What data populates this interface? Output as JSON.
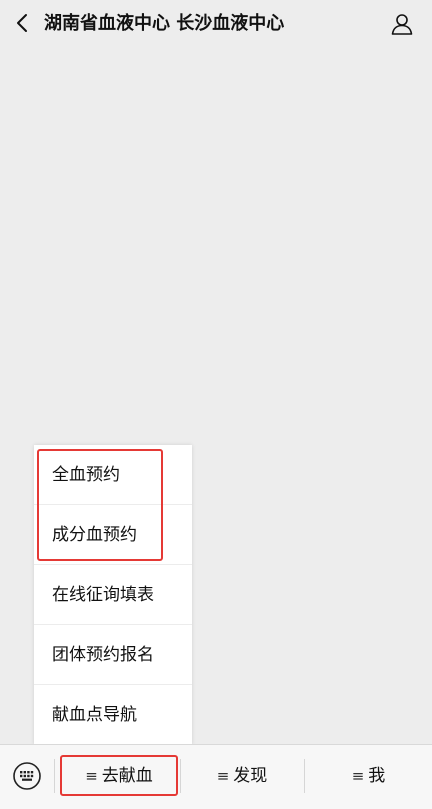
{
  "header": {
    "title": "湖南省血液中心 长沙血液中心"
  },
  "popup_menu": {
    "items": [
      {
        "label": "全血预约"
      },
      {
        "label": "成分血预约"
      },
      {
        "label": "在线征询填表"
      },
      {
        "label": "团体预约报名"
      },
      {
        "label": "献血点导航"
      }
    ]
  },
  "bottom_bar": {
    "tabs": [
      {
        "label": "去献血",
        "glyph": "≡"
      },
      {
        "label": "发现",
        "glyph": "≡"
      },
      {
        "label": "我",
        "glyph": "≡"
      }
    ]
  },
  "colors": {
    "background": "#ededed",
    "highlight": "#e53935"
  },
  "icons": [
    "back-arrow-icon",
    "profile-icon",
    "keyboard-icon",
    "menu-icon"
  ]
}
